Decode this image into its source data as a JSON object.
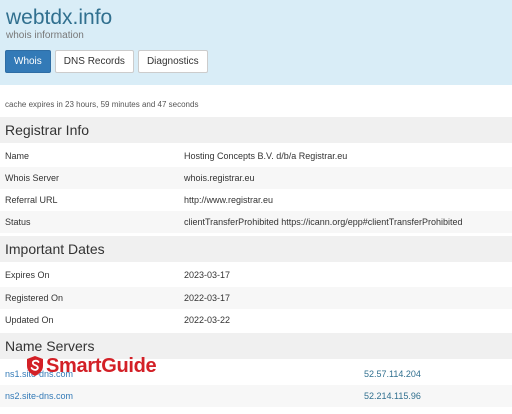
{
  "header": {
    "title": "webtdx.info",
    "subtitle": "whois information",
    "tabs": [
      "Whois",
      "DNS Records",
      "Diagnostics"
    ]
  },
  "cache_note": "cache expires in 23 hours, 59 minutes and 47 seconds",
  "registrar": {
    "heading": "Registrar Info",
    "rows": [
      {
        "key": "Name",
        "value": "Hosting Concepts B.V. d/b/a Registrar.eu"
      },
      {
        "key": "Whois Server",
        "value": "whois.registrar.eu"
      },
      {
        "key": "Referral URL",
        "value": "http://www.registrar.eu"
      },
      {
        "key": "Status",
        "value": "clientTransferProhibited https://icann.org/epp#clientTransferProhibited"
      }
    ]
  },
  "dates": {
    "heading": "Important Dates",
    "rows": [
      {
        "key": "Expires On",
        "value": "2023-03-17"
      },
      {
        "key": "Registered On",
        "value": "2022-03-17"
      },
      {
        "key": "Updated On",
        "value": "2022-03-22"
      }
    ]
  },
  "nameservers": {
    "heading": "Name Servers",
    "rows": [
      {
        "name": "ns1.site-dns.com",
        "ip": "52.57.114.204"
      },
      {
        "name": "ns2.site-dns.com",
        "ip": "52.214.115.96"
      }
    ]
  },
  "watermark": {
    "text": "SmartGuide",
    "color": "#d32027"
  },
  "colors": {
    "header_bg": "#d9edf7",
    "accent": "#337ab7",
    "title": "#31708f"
  }
}
